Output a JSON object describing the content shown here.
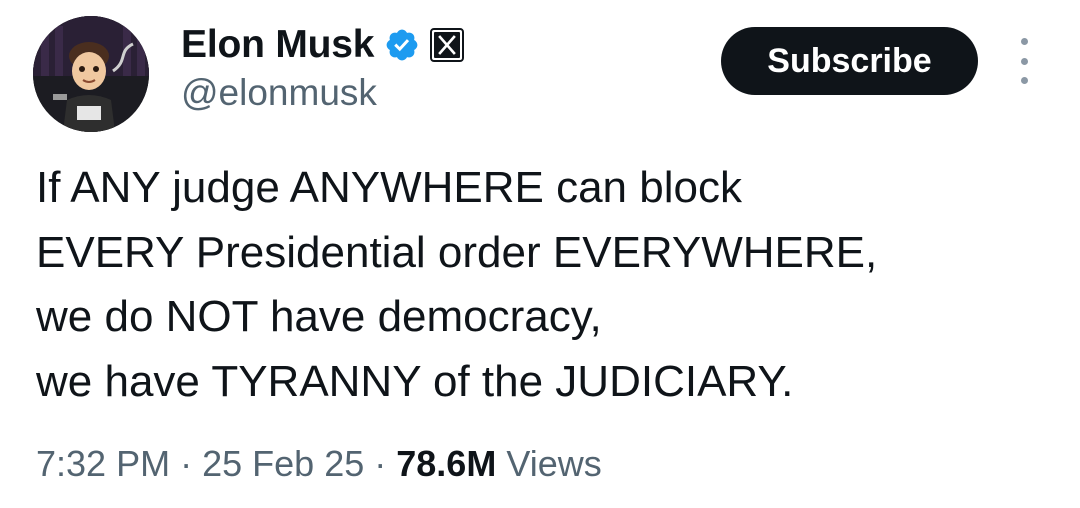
{
  "author": {
    "display_name": "Elon Musk",
    "handle": "@elonmusk",
    "verified_color": "#1d9bf0",
    "badges": [
      "verified-badge-icon",
      "x-affiliation-icon"
    ]
  },
  "actions": {
    "subscribe_label": "Subscribe",
    "more_icon": "more-vertical-icon"
  },
  "tweet": {
    "lines": [
      "If ANY judge ANYWHERE can block",
      "EVERY Presidential order EVERYWHERE,",
      "we do NOT have democracy,",
      "we have TYRANNY of the JUDICIARY."
    ]
  },
  "meta": {
    "time": "7:32 PM",
    "separator": "·",
    "date": "25 Feb 25",
    "views_count": "78.6M",
    "views_label": "Views"
  }
}
